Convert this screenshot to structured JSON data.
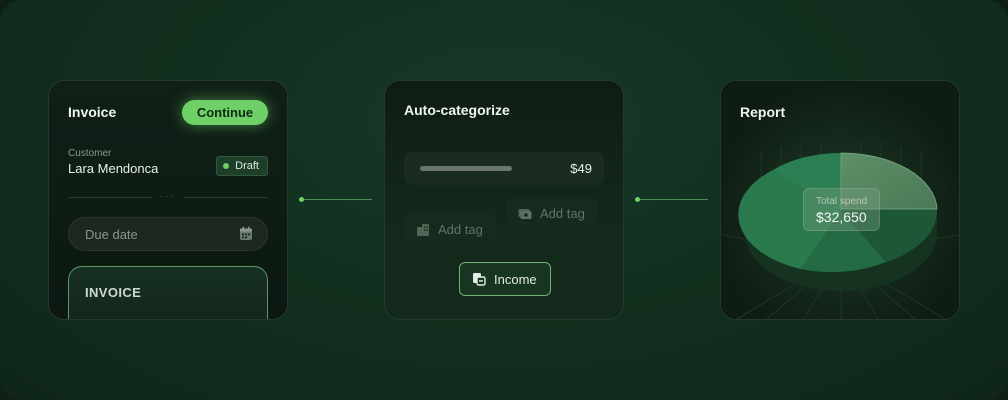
{
  "invoice": {
    "title": "Invoice",
    "continue_label": "Continue",
    "customer_label": "Customer",
    "customer_name": "Lara Mendonca",
    "status": "Draft",
    "due_date_placeholder": "Due date",
    "preview_label": "INVOICE"
  },
  "auto_categorize": {
    "title": "Auto-categorize",
    "amount": "$49",
    "tags": [
      {
        "label": "Add tag",
        "icon": "building-icon"
      },
      {
        "label": "Add tag",
        "icon": "cash-icon"
      }
    ],
    "income_label": "Income"
  },
  "report": {
    "title": "Report",
    "total_label": "Total spend",
    "total_value": "$32,650"
  },
  "colors": {
    "accent": "#6fd068",
    "background": "#12301f",
    "card": "#0f1c14"
  }
}
